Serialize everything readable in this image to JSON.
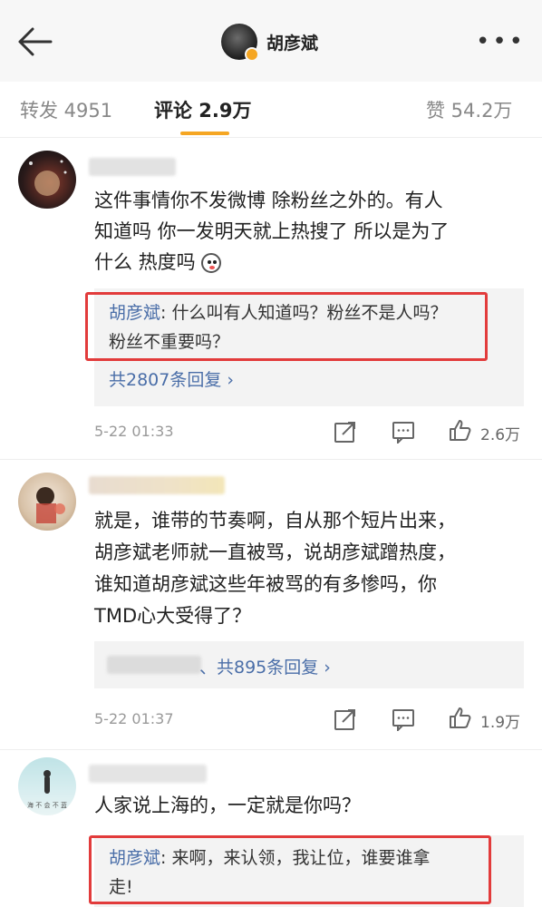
{
  "header": {
    "title": "胡彦斌",
    "more_label": "•••"
  },
  "tabs": [
    {
      "label": "转发 4951"
    },
    {
      "label": "评论 2.9万"
    },
    {
      "label": "赞 54.2万"
    }
  ],
  "comments": [
    {
      "text": "这件事情你不发微博 除粉丝之外的。有人知道吗 你一发明天就上热搜了 所以是为了什么 热度吗",
      "reply_name": "胡彦斌",
      "reply_text": ": 什么叫有人知道吗？粉丝不是人吗？粉丝不重要吗？",
      "reply_line2": "粉丝不重要吗？",
      "reply_line1_text": ": 什么叫有人知道吗？粉丝不是人吗？",
      "reply_count": "共2807条回复 ›",
      "time": "5-22 01:33",
      "likes": "2.6万"
    },
    {
      "text_lines": [
        "就是，谁带的节奏啊，自从那个短片出来，",
        "胡彦斌老师就一直被骂，说胡彦斌蹭热度，",
        "谁知道胡彦斌这些年被骂的有多惨吗，你",
        "TMD心大受得了？"
      ],
      "reply_count": "、共895条回复 ›",
      "time": "5-22 01:37",
      "likes": "1.9万"
    },
    {
      "text": "人家说上海的，一定就是你吗？",
      "avatar_caption": "海 不 会 不 蓝",
      "reply_name": "胡彦斌",
      "reply_line1_text": ": 来啊，来认领，我让位，谁要谁拿",
      "reply_line2": "走!"
    }
  ],
  "comment1_lines": [
    "这件事情你不发微博 除粉丝之外的。有人",
    "知道吗 你一发明天就上热搜了 所以是为了",
    "什么 热度吗"
  ]
}
